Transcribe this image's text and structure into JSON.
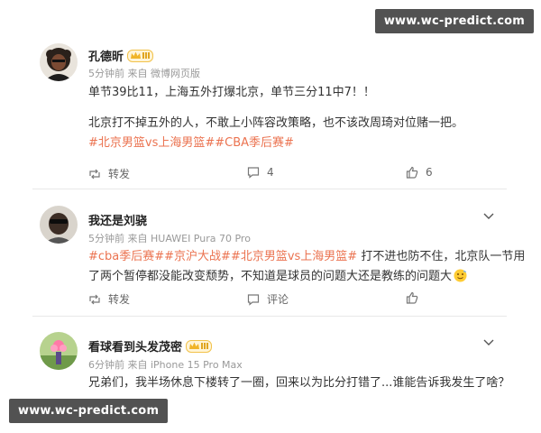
{
  "watermark": "www.wc-predict.com",
  "posts": [
    {
      "username": "孔德昕",
      "meta": "5分钟前 来自 微博网页版",
      "lines": [
        "单节39比11，上海五外打爆北京，单节三分11中7！！",
        "北京打不掉五外的人，不敢上小阵容改策略，也不该改周琦对位赌一把。"
      ],
      "tags": [
        "#北京男篮vs上海男篮#",
        "#CBA季后赛#"
      ],
      "repost_label": "转发",
      "comment_count": "4",
      "like_count": "6"
    },
    {
      "username": "我还是刘骁",
      "meta": "5分钟前 来自 HUAWEI Pura 70 Pro",
      "tags": [
        "#cba季后赛#",
        "#京沪大战#",
        "#北京男篮vs上海男篮#"
      ],
      "text_after_tags": " 打不进也防不住，北京队一节用",
      "line2": "了两个暂停都没能改变颓势，不知道是球员的问题大还是教练的问题大",
      "repost_label": "转发",
      "comment_label": "评论"
    },
    {
      "username": "看球看到头发茂密",
      "meta": "6分钟前 来自 iPhone 15 Pro Max",
      "text": "兄弟们，我半场休息下楼转了一圈，回来以为比分打错了...谁能告诉我发生了啥？"
    }
  ]
}
